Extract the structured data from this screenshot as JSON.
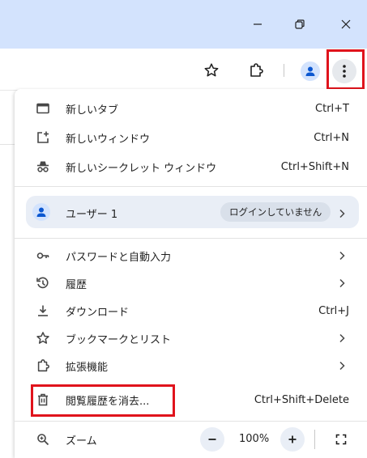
{
  "window": {
    "minimize_icon": "minimize-icon",
    "restore_icon": "restore-icon",
    "close_icon": "close-icon"
  },
  "toolbar": {
    "bookmark_icon": "star-icon",
    "extensions_icon": "puzzle-icon",
    "profile_icon": "person-icon",
    "menu_icon": "more-vertical-icon"
  },
  "menu": {
    "new_tab": {
      "label": "新しいタブ",
      "shortcut": "Ctrl+T"
    },
    "new_window": {
      "label": "新しいウィンドウ",
      "shortcut": "Ctrl+N"
    },
    "new_incognito": {
      "label": "新しいシークレット ウィンドウ",
      "shortcut": "Ctrl+Shift+N"
    },
    "profile": {
      "name": "ユーザー 1",
      "status": "ログインしていません"
    },
    "passwords": {
      "label": "パスワードと自動入力"
    },
    "history": {
      "label": "履歴"
    },
    "downloads": {
      "label": "ダウンロード",
      "shortcut": "Ctrl+J"
    },
    "bookmarks": {
      "label": "ブックマークとリスト"
    },
    "extensions": {
      "label": "拡張機能"
    },
    "clear_data": {
      "label": "閲覧履歴を消去...",
      "shortcut": "Ctrl+Shift+Delete"
    },
    "zoom": {
      "label": "ズーム",
      "value": "100%"
    }
  },
  "colors": {
    "titlebar": "#d3e3fd",
    "highlight_box": "#e0131c",
    "profile_row": "#e9eef6"
  }
}
